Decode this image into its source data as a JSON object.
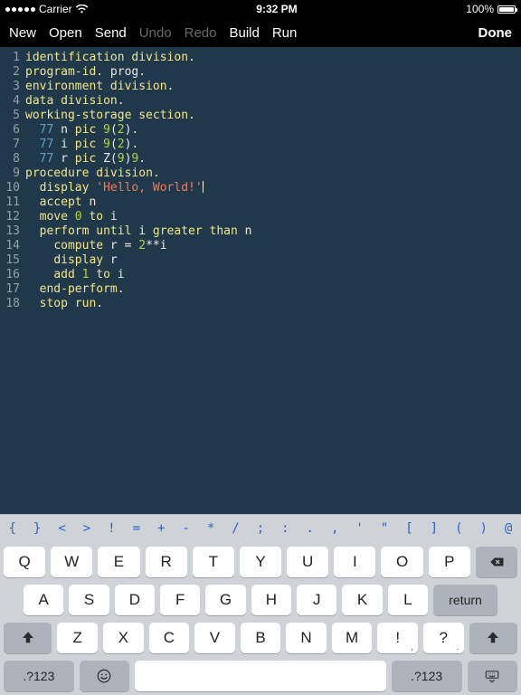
{
  "status": {
    "carrier": "Carrier",
    "time": "9:32 PM",
    "battery": "100%"
  },
  "toolbar": {
    "new": "New",
    "open": "Open",
    "send": "Send",
    "undo": "Undo",
    "redo": "Redo",
    "build": "Build",
    "run": "Run",
    "done": "Done"
  },
  "code": {
    "lines": [
      [
        [
          "kw",
          "identification"
        ],
        [
          "",
          " "
        ],
        [
          "kw",
          "division"
        ],
        [
          "",
          "."
        ]
      ],
      [
        [
          "kw",
          "program-id"
        ],
        [
          "",
          ". prog."
        ]
      ],
      [
        [
          "kw",
          "environment"
        ],
        [
          "",
          " "
        ],
        [
          "kw",
          "division"
        ],
        [
          "",
          "."
        ]
      ],
      [
        [
          "kw",
          "data"
        ],
        [
          "",
          " "
        ],
        [
          "kw",
          "division"
        ],
        [
          "",
          "."
        ]
      ],
      [
        [
          "kw",
          "working-storage"
        ],
        [
          "",
          " "
        ],
        [
          "kw",
          "section"
        ],
        [
          "",
          "."
        ]
      ],
      [
        [
          "",
          "  "
        ],
        [
          "lvl",
          "77"
        ],
        [
          "",
          " n "
        ],
        [
          "kw",
          "pic"
        ],
        [
          "",
          " "
        ],
        [
          "num",
          "9"
        ],
        [
          "",
          "("
        ],
        [
          "num",
          "2"
        ],
        [
          "",
          ")."
        ]
      ],
      [
        [
          "",
          "  "
        ],
        [
          "lvl",
          "77"
        ],
        [
          "",
          " i "
        ],
        [
          "kw",
          "pic"
        ],
        [
          "",
          " "
        ],
        [
          "num",
          "9"
        ],
        [
          "",
          "("
        ],
        [
          "num",
          "2"
        ],
        [
          "",
          ")."
        ]
      ],
      [
        [
          "",
          "  "
        ],
        [
          "lvl",
          "77"
        ],
        [
          "",
          " r "
        ],
        [
          "kw",
          "pic"
        ],
        [
          "",
          " Z("
        ],
        [
          "num",
          "9"
        ],
        [
          "",
          ")"
        ],
        [
          "num",
          "9"
        ],
        [
          "",
          "."
        ]
      ],
      [
        [
          "kw",
          "procedure"
        ],
        [
          "",
          " "
        ],
        [
          "kw",
          "division"
        ],
        [
          "",
          "."
        ]
      ],
      [
        [
          "",
          "  "
        ],
        [
          "kw",
          "display"
        ],
        [
          "",
          " "
        ],
        [
          "str",
          "'Hello, World!'"
        ],
        [
          "cursor",
          ""
        ]
      ],
      [
        [
          "",
          "  "
        ],
        [
          "kw",
          "accept"
        ],
        [
          "",
          " n"
        ]
      ],
      [
        [
          "",
          "  "
        ],
        [
          "kw",
          "move"
        ],
        [
          "",
          " "
        ],
        [
          "num",
          "0"
        ],
        [
          "",
          " "
        ],
        [
          "kw",
          "to"
        ],
        [
          "",
          " i"
        ]
      ],
      [
        [
          "",
          "  "
        ],
        [
          "kw",
          "perform"
        ],
        [
          "",
          " "
        ],
        [
          "kw",
          "until"
        ],
        [
          "",
          " i "
        ],
        [
          "kw",
          "greater"
        ],
        [
          "",
          " "
        ],
        [
          "kw",
          "than"
        ],
        [
          "",
          " n"
        ]
      ],
      [
        [
          "",
          "    "
        ],
        [
          "kw",
          "compute"
        ],
        [
          "",
          " r = "
        ],
        [
          "num",
          "2"
        ],
        [
          "",
          "**i"
        ]
      ],
      [
        [
          "",
          "    "
        ],
        [
          "kw",
          "display"
        ],
        [
          "",
          " r"
        ]
      ],
      [
        [
          "",
          "    "
        ],
        [
          "kw",
          "add"
        ],
        [
          "",
          " "
        ],
        [
          "num",
          "1"
        ],
        [
          "",
          " "
        ],
        [
          "kw",
          "to"
        ],
        [
          "",
          " i"
        ]
      ],
      [
        [
          "",
          "  "
        ],
        [
          "kw",
          "end-perform"
        ],
        [
          "",
          "."
        ]
      ],
      [
        [
          "",
          "  "
        ],
        [
          "kw",
          "stop"
        ],
        [
          "",
          " "
        ],
        [
          "kw",
          "run"
        ],
        [
          "",
          "."
        ]
      ]
    ]
  },
  "symbols": [
    "{",
    "}",
    "<",
    ">",
    "!",
    "=",
    "+",
    "-",
    "*",
    "/",
    ";",
    ":",
    ".",
    ",",
    "'",
    "\"",
    "[",
    "]",
    "(",
    ")",
    "@"
  ],
  "keyboard": {
    "row1": [
      "Q",
      "W",
      "E",
      "R",
      "T",
      "Y",
      "U",
      "I",
      "O",
      "P"
    ],
    "row2": [
      "A",
      "S",
      "D",
      "F",
      "G",
      "H",
      "J",
      "K",
      "L"
    ],
    "row3": [
      "Z",
      "X",
      "C",
      "V",
      "B",
      "N",
      "M"
    ],
    "punct1": {
      "main": "!",
      "sub": ","
    },
    "punct2": {
      "main": "?",
      "sub": "."
    },
    "numKey": ".?123",
    "return": "return"
  }
}
